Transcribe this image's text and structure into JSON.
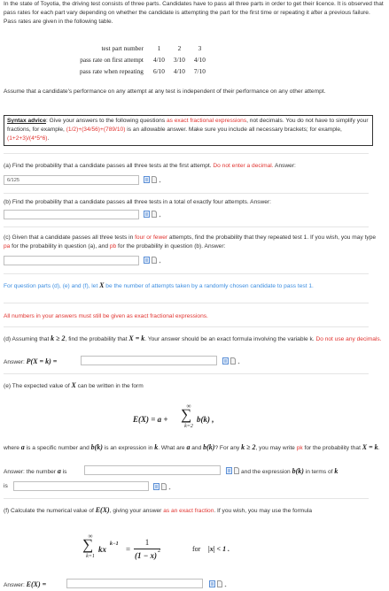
{
  "intro": {
    "paragraph": "In the state of Toyotia, the driving test consists of three parts. Candidates have to pass all three parts in order to get their licence. It is observed that pass rates for each part vary depending on whether the candidate is attempting the part for the first time or repeating it after a previous failure. Pass rates are given in the following table."
  },
  "rates_table": {
    "header_label": "test part number",
    "parts": [
      "1",
      "2",
      "3"
    ],
    "rows": [
      {
        "label": "pass rate on first attempt",
        "values": [
          "4/10",
          "3/10",
          "4/10"
        ]
      },
      {
        "label": "pass rate when repeating",
        "values": [
          "6/10",
          "4/10",
          "7/10"
        ]
      }
    ]
  },
  "assumption": "Assume that a candidate's performance on any attempt at any test is independent of their performance on any other attempt.",
  "syntax": {
    "label": "Syntax advice",
    "text1": ": Give your answers to the following questions ",
    "red1": "as exact fractional expressions",
    "text2": ", not decimals. You do not have to simplify your fractions, for example, ",
    "red2": "(1/2)+(34/56)+(789/10)",
    "text3": " is an allowable answer. Make sure you include all necessary brackets; for example, ",
    "red3": "(1+2+3)/(4*5*6)",
    "text4": "."
  },
  "part_a": {
    "text": "(a) Find the probability that a candidate passes all three tests at the first attempt. ",
    "red": "Do not enter a decimal.",
    "answer_label": " Answer:",
    "answer_value": "6/125"
  },
  "part_b": {
    "text": "(b) Find the probability that a candidate passes all three tests in a total of exactly four attempts. Answer:"
  },
  "part_c": {
    "t1": "(c) Given that a candidate passes all three tests in ",
    "r1": "four or fewer",
    "t2": " attempts, find the probability that they repeated test 1. If you wish, you may type ",
    "r2": "pa",
    "t3": " for the probability in question (a), and ",
    "r3": "pb",
    "t4": " for the probability in question (b). Answer:"
  },
  "note_def": {
    "t1": "For question parts (d), (e) and (f), let ",
    "var": "X",
    "t2": " be the number of attempts taken by a randomly chosen candidate to pass test 1."
  },
  "note_exact": "All numbers in your answers must still be given as exact fractional expressions.",
  "part_d": {
    "t1": "(d) Assuming that ",
    "cond": "k ≥ 2",
    "t2": ", find the probability that ",
    "eq": "X = k",
    "t3": ". Your answer should be an exact formula involving the variable k. ",
    "red": "Do not use any decimals.",
    "answer_label": "Answer: ",
    "answer_math": "P(X = k) ="
  },
  "part_e": {
    "intro": "(e) The expected value of ",
    "var": "X",
    "intro2": " can be written in the form",
    "formula_lhs": "E(X) = a +",
    "formula_sum_top": "∞",
    "formula_sum_bottom": "k=2",
    "formula_term": "b(k) ,",
    "t1": "where ",
    "a": "a",
    "t2": " is a specific number and ",
    "bk": "b(k)",
    "t3": " is an expression in ",
    "k": "k",
    "t4": ". What are ",
    "t5": " and ",
    "t6": "? For any ",
    "cond": "k ≥ 2",
    "t7": ", you may write ",
    "pk": "pk",
    "t8": " for the probability that ",
    "eq": "X = k",
    "t9": ".",
    "ans_a_label": "Answer: the number ",
    "ans_a_is": " is",
    "ans_b_label": " and the expression ",
    "ans_b_label2": " in terms of ",
    "is_word": "is"
  },
  "part_f": {
    "t1": "(f) Calculate the numerical value of ",
    "ex": "E(X)",
    "t2": ", giving your answer ",
    "red": "as an exact fraction",
    "t3": ". If you wish, you may use the formula",
    "sum_top": "∞",
    "sum_bottom": "k=1",
    "term": "kx",
    "term_exp": "k−1",
    "eq": "=",
    "frac_num": "1",
    "frac_den": "(1 − x)",
    "frac_den_exp": "2",
    "for_text": "for",
    "cond": "|x| < 1 .",
    "answer_label": "Answer: ",
    "answer_math": "E(X) ="
  }
}
